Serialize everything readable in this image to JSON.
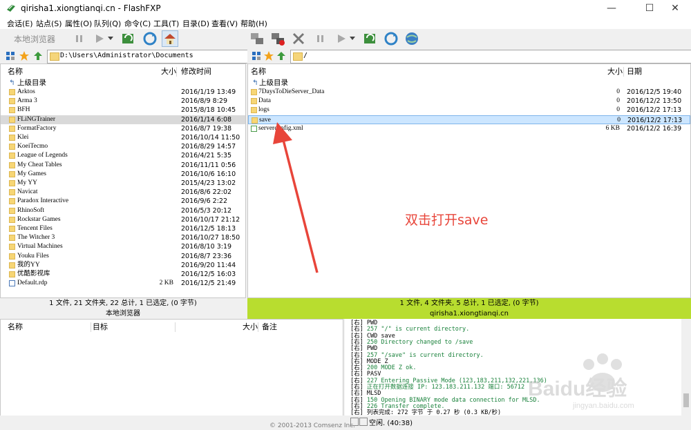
{
  "window": {
    "title": "qirisha1.xiongtianqi.cn - FlashFXP"
  },
  "menu": [
    {
      "label": "会话(E)"
    },
    {
      "label": "站点(S)"
    },
    {
      "label": "属性(O)"
    },
    {
      "label": "队列(Q)"
    },
    {
      "label": "命令(C)"
    },
    {
      "label": "工具(T)"
    },
    {
      "label": "目录(D)"
    },
    {
      "label": "查看(V)"
    },
    {
      "label": "帮助(H)"
    }
  ],
  "local": {
    "browser_label": "本地浏览器",
    "path": "D:\\Users\\Administrator\\Documents",
    "headers": {
      "name": "名称",
      "size": "大小",
      "date": "修改时间"
    },
    "parent": "上级目录",
    "files": [
      {
        "name": "Arktos",
        "size": "",
        "date": "2016/1/19 13:49"
      },
      {
        "name": "Arma 3",
        "size": "",
        "date": "2016/8/9 8:29"
      },
      {
        "name": "BFH",
        "size": "",
        "date": "2015/8/18 10:45"
      },
      {
        "name": "FLiNGTrainer",
        "size": "",
        "date": "2016/1/14 6:08"
      },
      {
        "name": "FormatFactory",
        "size": "",
        "date": "2016/8/7 19:38"
      },
      {
        "name": "Klei",
        "size": "",
        "date": "2016/10/14 11:50"
      },
      {
        "name": "KoeiTecmo",
        "size": "",
        "date": "2016/8/29 14:57"
      },
      {
        "name": "League of Legends",
        "size": "",
        "date": "2016/4/21 5:35"
      },
      {
        "name": "My Cheat Tables",
        "size": "",
        "date": "2016/11/11 0:56"
      },
      {
        "name": "My Games",
        "size": "",
        "date": "2016/10/6 16:10"
      },
      {
        "name": "My YY",
        "size": "",
        "date": "2015/4/23 13:02"
      },
      {
        "name": "Navicat",
        "size": "",
        "date": "2016/8/6 22:02"
      },
      {
        "name": "Paradox Interactive",
        "size": "",
        "date": "2016/9/6 2:22"
      },
      {
        "name": "RhinoSoft",
        "size": "",
        "date": "2016/5/3 20:12"
      },
      {
        "name": "Rockstar Games",
        "size": "",
        "date": "2016/10/17 21:12"
      },
      {
        "name": "Tencent Files",
        "size": "",
        "date": "2016/12/5 18:13"
      },
      {
        "name": "The Witcher 3",
        "size": "",
        "date": "2016/10/27 18:50"
      },
      {
        "name": "Virtual Machines",
        "size": "",
        "date": "2016/8/10 3:19"
      },
      {
        "name": "Youku Files",
        "size": "",
        "date": "2016/8/7 23:36"
      },
      {
        "name": "我的YY",
        "size": "",
        "date": "2016/9/20 11:44"
      },
      {
        "name": "优酷影视库",
        "size": "",
        "date": "2016/12/5 16:03"
      },
      {
        "name": "Default.rdp",
        "size": "2 KB",
        "date": "2016/12/5 21:49"
      }
    ],
    "status": "1 文件, 21 文件夹, 22 总计, 1 已选定, (0 字节)"
  },
  "remote": {
    "path": "/",
    "host": "qirisha1.xiongtianqi.cn",
    "headers": {
      "name": "名称",
      "size": "大小",
      "date": "日期"
    },
    "parent": "上级目录",
    "files": [
      {
        "name": "7DaysToDieServer_Data",
        "size": "0",
        "date": "2016/12/5 19:40"
      },
      {
        "name": "Data",
        "size": "0",
        "date": "2016/12/2 13:50"
      },
      {
        "name": "logs",
        "size": "0",
        "date": "2016/12/2 17:13"
      },
      {
        "name": "save",
        "size": "0",
        "date": "2016/12/2 17:13"
      },
      {
        "name": "serverconfig.xml",
        "size": "6 KB",
        "date": "2016/12/2 16:39"
      }
    ],
    "status": "1 文件, 4 文件夹, 5 总计, 1 已选定, (0 字节)",
    "annotation": "双击打开save"
  },
  "queue": {
    "headers": {
      "name": "名称",
      "target": "目标",
      "size": "大小",
      "note": "备注"
    }
  },
  "log": [
    {
      "tag": "[右]",
      "text": "PWD",
      "green": false
    },
    {
      "tag": "[右]",
      "text": "257 \"/\" is current directory.",
      "green": true
    },
    {
      "tag": "[右]",
      "text": "CWD save",
      "green": false
    },
    {
      "tag": "[右]",
      "text": "250 Directory changed to /save",
      "green": true
    },
    {
      "tag": "[右]",
      "text": "PWD",
      "green": false
    },
    {
      "tag": "[右]",
      "text": "257 \"/save\" is current directory.",
      "green": true
    },
    {
      "tag": "[右]",
      "text": "MODE Z",
      "green": false
    },
    {
      "tag": "[右]",
      "text": "200 MODE Z ok.",
      "green": true
    },
    {
      "tag": "[右]",
      "text": "PASV",
      "green": false
    },
    {
      "tag": "[右]",
      "text": "227 Entering Passive Mode (123,183,211,132,221,136)",
      "green": true
    },
    {
      "tag": "[右]",
      "text": "正在打开数据连接 IP: 123.183.211.132 端口: 56712",
      "green": true
    },
    {
      "tag": "[右]",
      "text": "MLSD",
      "green": false
    },
    {
      "tag": "[右]",
      "text": "150 Opening BINARY mode data connection for MLSD.",
      "green": true
    },
    {
      "tag": "[右]",
      "text": "226 Transfer complete.",
      "green": true
    },
    {
      "tag": "[右]",
      "text": "列表完成: 272 字节 于 0.27 秒 (0.3 KB/秒)",
      "green": false
    }
  ],
  "footer": {
    "idle": "空闲. (40:38)",
    "copyright": "© 2001-2013 Comsenz Inc."
  },
  "watermark": {
    "brand": "Baidu经验",
    "url": "jingyan.baidu.com"
  }
}
